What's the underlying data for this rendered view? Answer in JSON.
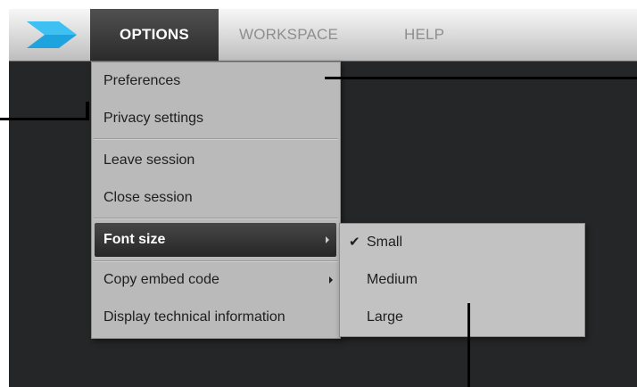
{
  "menubar": {
    "tabs": [
      {
        "label": "OPTIONS"
      },
      {
        "label": "WORKSPACE"
      },
      {
        "label": "HELP"
      }
    ]
  },
  "options_menu": {
    "items": [
      {
        "label": "Preferences"
      },
      {
        "label": "Privacy settings"
      },
      {
        "label": "Leave session"
      },
      {
        "label": "Close session"
      },
      {
        "label": "Font size"
      },
      {
        "label": "Copy embed code"
      },
      {
        "label": "Display technical information"
      }
    ]
  },
  "font_size_submenu": {
    "items": [
      {
        "label": "Small"
      },
      {
        "label": "Medium"
      },
      {
        "label": "Large"
      }
    ],
    "checkmark": "✔"
  },
  "colors": {
    "menubar_bg": "#dedede",
    "active_tab_bg": "#2b2b2b",
    "menu_bg": "#bababa",
    "highlight_bg": "#262626",
    "workspace_bg": "#252627",
    "logo_blue": "#1fa3df"
  }
}
